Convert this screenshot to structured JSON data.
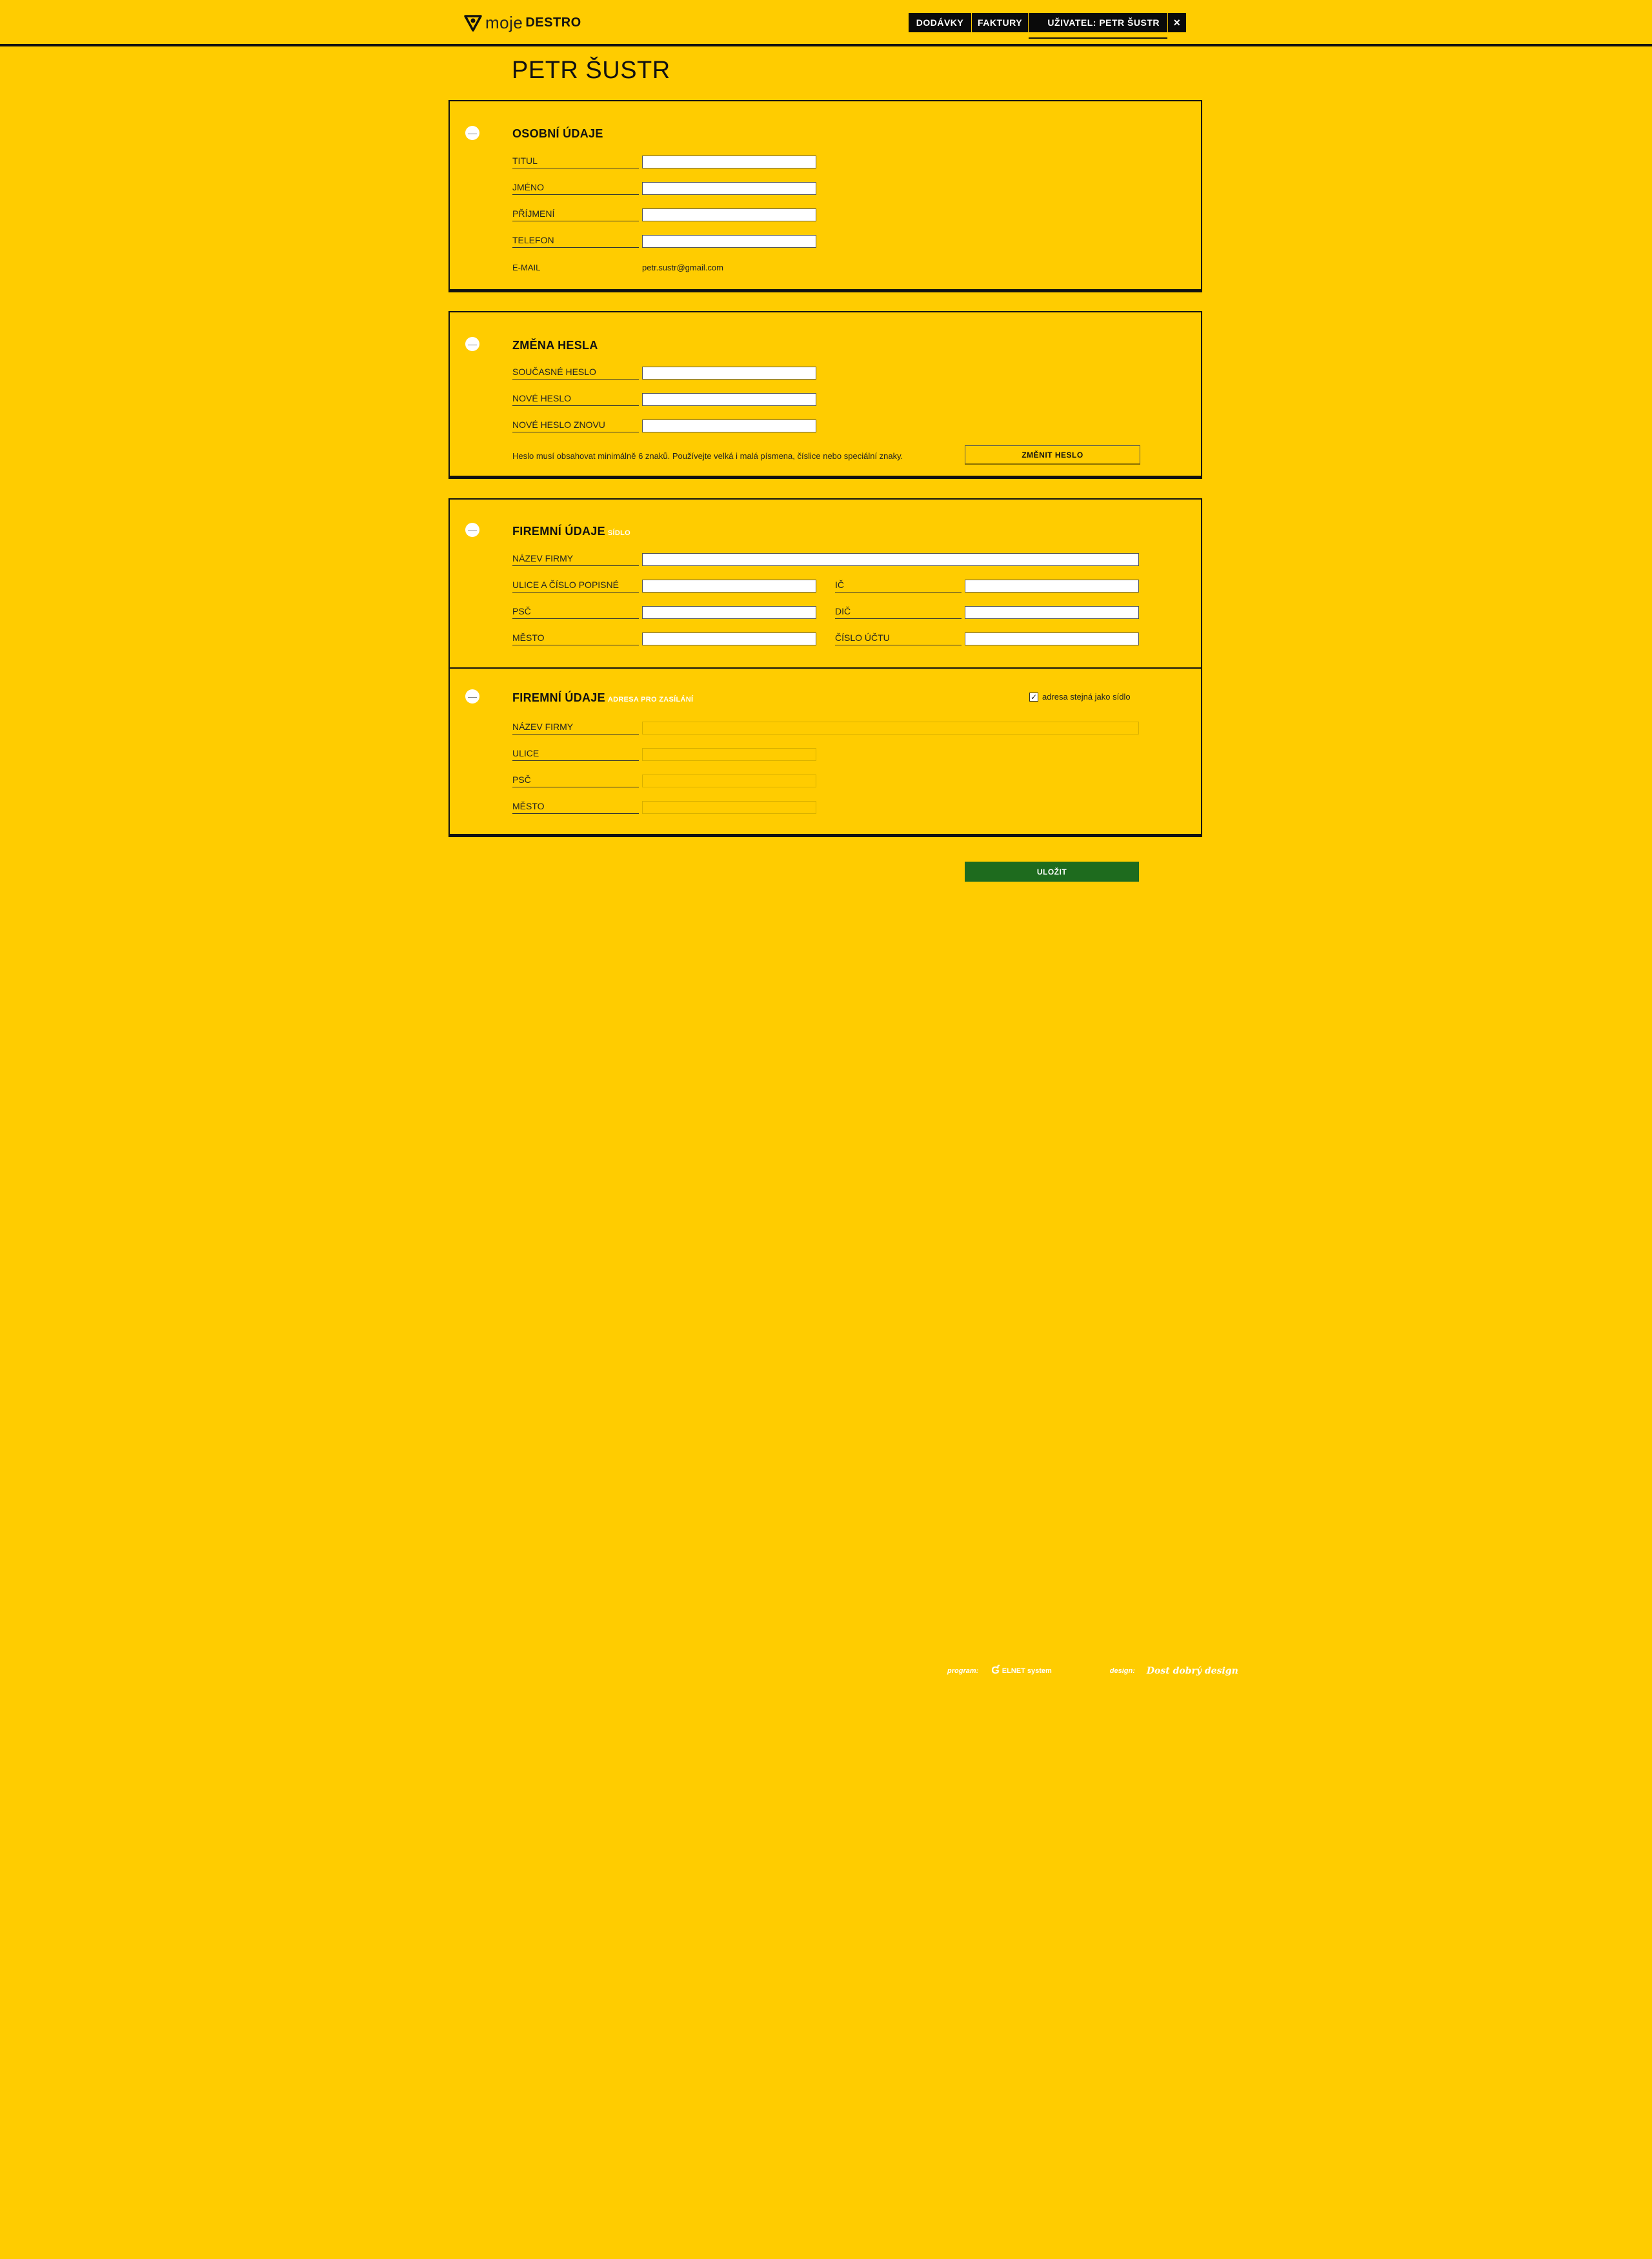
{
  "header": {
    "logo_moje": "moje",
    "logo_destro": "DESTRO",
    "nav": {
      "deliveries": "DODÁVKY",
      "invoices": "FAKTURY",
      "user": "UŽIVATEL: PETR ŠUSTR",
      "close": "×"
    }
  },
  "page_title": "PETR ŠUSTR",
  "personal": {
    "title": "OSOBNÍ ÚDAJE",
    "toggle": "—",
    "fields": {
      "titul": "TITUL",
      "jmeno": "JMÉNO",
      "prijmeni": "PŘÍJMENÍ",
      "telefon": "TELEFON",
      "email_label": "E-MAIL",
      "email_value": "petr.sustr@gmail.com"
    }
  },
  "password": {
    "title": "ZMĚNA HESLA",
    "toggle": "—",
    "current": "SOUČASNÉ HESLO",
    "new": "NOVÉ HESLO",
    "repeat": "NOVÉ HESLO ZNOVU",
    "hint": "Heslo musí obsahovat minimálně 6 znaků. Používejte velká i malá písmena, číslice nebo speciální znaky.",
    "button": "ZMĚNIT HESLO"
  },
  "company": {
    "title": "FIREMNÍ ÚDAJE",
    "subtitle": "SÍDLO",
    "toggle": "—",
    "name": "NÁZEV FIRMY",
    "street": "ULICE A ČÍSLO POPISNÉ",
    "zip": "PSČ",
    "city": "MĚSTO",
    "ic": "IČ",
    "dic": "DIČ",
    "account": "ČÍSLO ÚČTU"
  },
  "shipping": {
    "title": "FIREMNÍ ÚDAJE",
    "subtitle": "ADRESA PRO ZASÍLÁNÍ",
    "toggle": "—",
    "same_as_seat": "adresa stejná jako sídlo",
    "same_checked": true,
    "name": "NÁZEV FIRMY",
    "street": "ULICE",
    "zip": "PSČ",
    "city": "MĚSTO"
  },
  "save_button": "ULOŽIT",
  "footer": {
    "program_label": "program:",
    "program_brand": "ELNET system",
    "design_label": "design:",
    "design_brand": "Dost dobrý design"
  }
}
